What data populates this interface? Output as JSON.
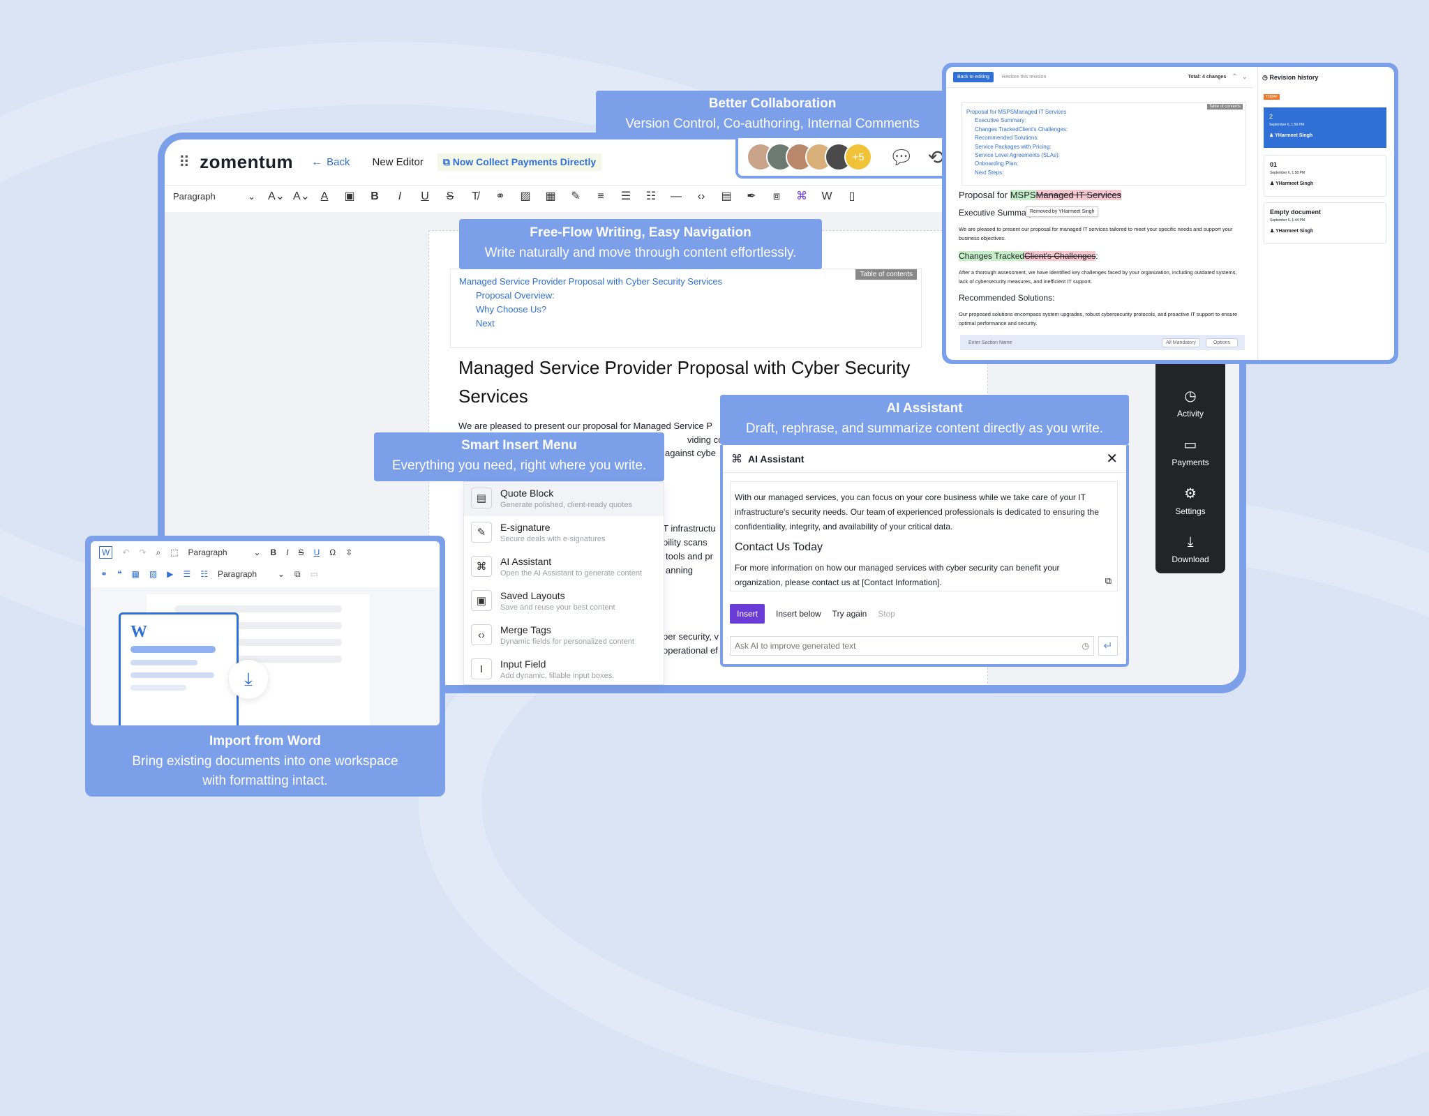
{
  "colors": {
    "accent": "#7b9fe9",
    "brand_blue": "#2f6fd6",
    "purple": "#6a3bd6",
    "dark_sidebar": "#222428"
  },
  "editor": {
    "logo": "zomentum",
    "back": "Back",
    "new_editor": "New Editor",
    "collect": "Now Collect Payments Directly",
    "paragraph": "Paragraph",
    "toc_tag": "Table of contents",
    "toc": [
      "Managed Service Provider Proposal with Cyber Security Services",
      "Proposal Overview:",
      "Why Choose Us?",
      "Next"
    ],
    "heading": "Managed Service Provider Proposal with Cyber Security Services",
    "body_lines": [
      "We are pleased to present our proposal for Managed Service P",
      "viding compre",
      "against cybe",
      "T infrastructu",
      "bility scans",
      "tools and pr",
      "anning",
      "ber security, v",
      "operational ef"
    ]
  },
  "captions": {
    "collab": {
      "title": "Better Collaboration",
      "sub": "Version Control, Co-authoring, Internal Comments"
    },
    "freeflow": {
      "title": "Free-Flow Writing, Easy Navigation",
      "sub": "Write naturally and move through content effortlessly."
    },
    "insert": {
      "title": "Smart Insert Menu",
      "sub": "Everything you need, right where you write."
    },
    "ai": {
      "title": "AI Assistant",
      "sub": "Draft, rephrase, and summarize content directly as you write."
    },
    "word": {
      "title": "Import from Word",
      "sub1": "Bring existing documents into one workspace",
      "sub2": "with formatting intact."
    }
  },
  "avatars": {
    "more": "+5"
  },
  "insert_menu": [
    {
      "label": "Quote Block",
      "desc": "Generate polished, client-ready quotes",
      "icon": "▤"
    },
    {
      "label": "E-signature",
      "desc": "Secure deals with e-signatures",
      "icon": "✎"
    },
    {
      "label": "AI Assistant",
      "desc": "Open the AI Assistant to generate content",
      "icon": "⌘"
    },
    {
      "label": "Saved Layouts",
      "desc": "Save and reuse your best content",
      "icon": "▣"
    },
    {
      "label": "Merge Tags",
      "desc": "Dynamic fields for personalized content",
      "icon": "‹›"
    },
    {
      "label": "Input Field",
      "desc": "Add dynamic, fillable input boxes.",
      "icon": "I"
    }
  ],
  "ai_panel": {
    "title": "AI Assistant",
    "para1": "With our managed services, you can focus on your core business while we take care of your IT infrastructure's security needs. Our team of experienced professionals is dedicated to ensuring the confidentiality, integrity, and availability of your critical data.",
    "heading": "Contact Us Today",
    "para2": "For more information on how our managed services with cyber security can benefit your organization, please contact us at [Contact Information].",
    "insert": "Insert",
    "insert_below": "Insert below",
    "try_again": "Try again",
    "stop": "Stop",
    "placeholder": "Ask AI to improve generated text"
  },
  "sidebar": [
    {
      "label": "Activity",
      "icon": "◷"
    },
    {
      "label": "Payments",
      "icon": "▭"
    },
    {
      "label": "Settings",
      "icon": "⚙"
    },
    {
      "label": "Download",
      "icon": "⤓"
    }
  ],
  "revision": {
    "back": "Back to editing",
    "restore": "Restore this revision",
    "total": "Total: 4 changes",
    "history": "Revision history",
    "today": "TODAY",
    "toc_tag": "Table of contents",
    "toc": [
      "Proposal for MSPSManaged IT Services",
      "Executive Summary:",
      "Changes TrackedClient's Challenges:",
      "Recommended Solutions:",
      "Service Packages with Pricing:",
      "Service Level Agreements (SLAs):",
      "Onboarding Plan:",
      "Next Steps:"
    ],
    "proposal_prefix": "Proposal for ",
    "proposal_added": "MSPS",
    "proposal_removed": "Managed IT Services",
    "exec": "Executive Summary",
    "removed_by": "Removed by YHarmeet Singh",
    "exec_text": "We are pleased to present our proposal for managed IT services tailored to meet your specific needs and support your business objectives.",
    "changes_added": "Changes Tracked",
    "changes_removed": "Client's Challenges",
    "changes_text": "After a thorough assessment, we have identified key challenges faced by your organization, including outdated systems, lack of cybersecurity measures, and inefficient IT support.",
    "rec": "Recommended Solutions:",
    "rec_text": "Our proposed solutions encompass system upgrades, robust cybersecurity protocols, and proactive IT support to ensure optimal performance and security.",
    "section_ph": "Enter Section Name",
    "mandatory": "All Mandatory",
    "options": "Options",
    "cards": [
      {
        "num": "2",
        "date": "September 6, 1:59 PM",
        "user": "YHarmeet Singh"
      },
      {
        "num": "01",
        "date": "September 6, 1:58 PM",
        "user": "YHarmeet Singh"
      },
      {
        "num": "Empty document",
        "date": "September 6, 1:44 PM",
        "user": "YHarmeet Singh"
      }
    ]
  },
  "word_import": {
    "paragraph": "Paragraph",
    "paragraph2": "Paragraph",
    "logo_letter": "W"
  }
}
